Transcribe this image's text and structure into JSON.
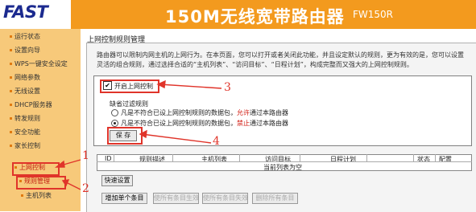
{
  "header": {
    "logo": "FAST",
    "title": "150M无线宽带路由器",
    "model": "FW150R"
  },
  "sidebar": {
    "items": [
      {
        "label": "运行状态"
      },
      {
        "label": "设置向导"
      },
      {
        "label": "WPS一键安全设定"
      },
      {
        "label": "网络参数"
      },
      {
        "label": "无线设置"
      },
      {
        "label": "DHCP服务器"
      },
      {
        "label": "转发规则"
      },
      {
        "label": "安全功能"
      },
      {
        "label": "家长控制"
      },
      {
        "label": "上网控制"
      },
      {
        "label": "规则管理"
      },
      {
        "label": "主机列表"
      }
    ]
  },
  "panel": {
    "title": "上网控制规则管理",
    "description": "路由器可以限制内网主机的上网行为。在本页面，您可以打开或者关闭此功能，并且设定默认的规则，更为有效的是，您可以设置灵活的组合规则，通过选择合适的“主机列表”、“访问目标”、“日程计划”，构成完整而又强大的上网控制规则。",
    "enable_label": "开启上网控制",
    "default_rule_label": "缺省过滤规则",
    "options": [
      {
        "prefix": "凡是不符合已设上网控制规则的数据包，",
        "highlight": "允许",
        "suffix": "通过本路由器",
        "selected": false
      },
      {
        "prefix": "凡是不符合已设上网控制规则的数据包，",
        "highlight": "禁止",
        "suffix": "通过本路由器",
        "selected": true
      }
    ],
    "save_label": "保 存"
  },
  "table": {
    "headers": [
      "ID",
      "规则描述",
      "主机列表",
      "访问目标",
      "日程计划",
      "状态",
      "配置"
    ],
    "empty_text": "当前列表为空"
  },
  "buttons": {
    "quick": "快速设置",
    "add": "增加单个条目",
    "enable_all": "使所有条目生效",
    "disable_all": "使所有条目失效",
    "delete_all": "删除所有条目"
  },
  "annotations": [
    "1",
    "2",
    "3",
    "4"
  ],
  "colors": {
    "header": "#f39a1e",
    "sidebar": "#f7c97a",
    "annotation": "#e0342a",
    "logo": "#1b2a8f"
  }
}
